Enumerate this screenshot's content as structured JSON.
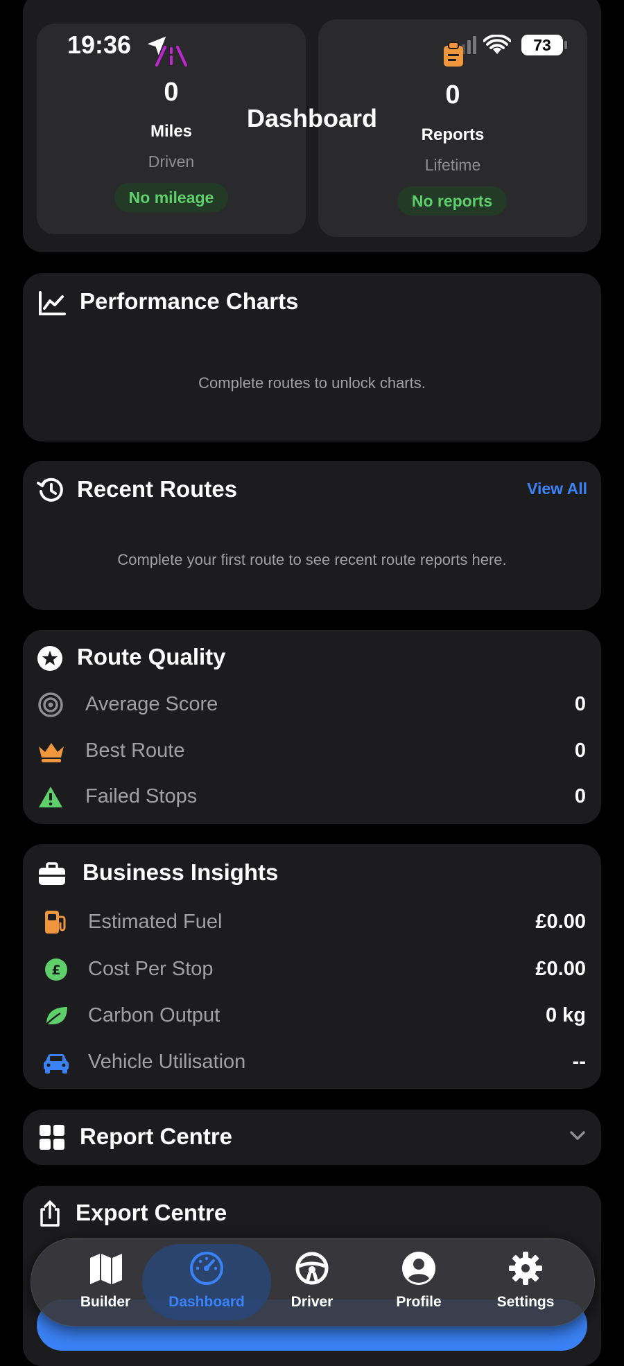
{
  "status_bar": {
    "time": "19:36",
    "battery": "73"
  },
  "header": {
    "title": "Dashboard"
  },
  "stats": {
    "miles": {
      "value": "0",
      "label": "Miles",
      "sub": "Driven",
      "pill": "No mileage"
    },
    "reports": {
      "value": "0",
      "label": "Reports",
      "sub": "Lifetime",
      "pill": "No reports"
    }
  },
  "performance": {
    "title": "Performance Charts",
    "empty": "Complete routes to unlock charts."
  },
  "recent_routes": {
    "title": "Recent Routes",
    "view_all": "View All",
    "empty": "Complete your first route to see recent route reports here."
  },
  "route_quality": {
    "title": "Route Quality",
    "rows": [
      {
        "label": "Average Score",
        "value": "0",
        "icon": "target-icon"
      },
      {
        "label": "Best Route",
        "value": "0",
        "icon": "crown-icon"
      },
      {
        "label": "Failed Stops",
        "value": "0",
        "icon": "warning-icon"
      }
    ]
  },
  "business": {
    "title": "Business Insights",
    "rows": [
      {
        "label": "Estimated Fuel",
        "value": "£0.00",
        "icon": "fuel-icon"
      },
      {
        "label": "Cost Per Stop",
        "value": "£0.00",
        "icon": "pound-icon"
      },
      {
        "label": "Carbon Output",
        "value": "0 kg",
        "icon": "leaf-icon"
      },
      {
        "label": "Vehicle Utilisation",
        "value": "--",
        "icon": "car-icon"
      }
    ]
  },
  "report_centre": {
    "title": "Report Centre"
  },
  "export_centre": {
    "title": "Export Centre"
  },
  "tabbar": {
    "items": [
      {
        "label": "Builder",
        "icon": "map-icon"
      },
      {
        "label": "Dashboard",
        "icon": "gauge-icon"
      },
      {
        "label": "Driver",
        "icon": "steering-wheel-icon"
      },
      {
        "label": "Profile",
        "icon": "profile-icon"
      },
      {
        "label": "Settings",
        "icon": "gear-icon"
      }
    ],
    "active": "Dashboard"
  },
  "colors": {
    "accent": "#3b82f6",
    "green": "#5ecf6a",
    "orange": "#f0963c",
    "card": "#1c1c1e",
    "bg": "#000000"
  }
}
